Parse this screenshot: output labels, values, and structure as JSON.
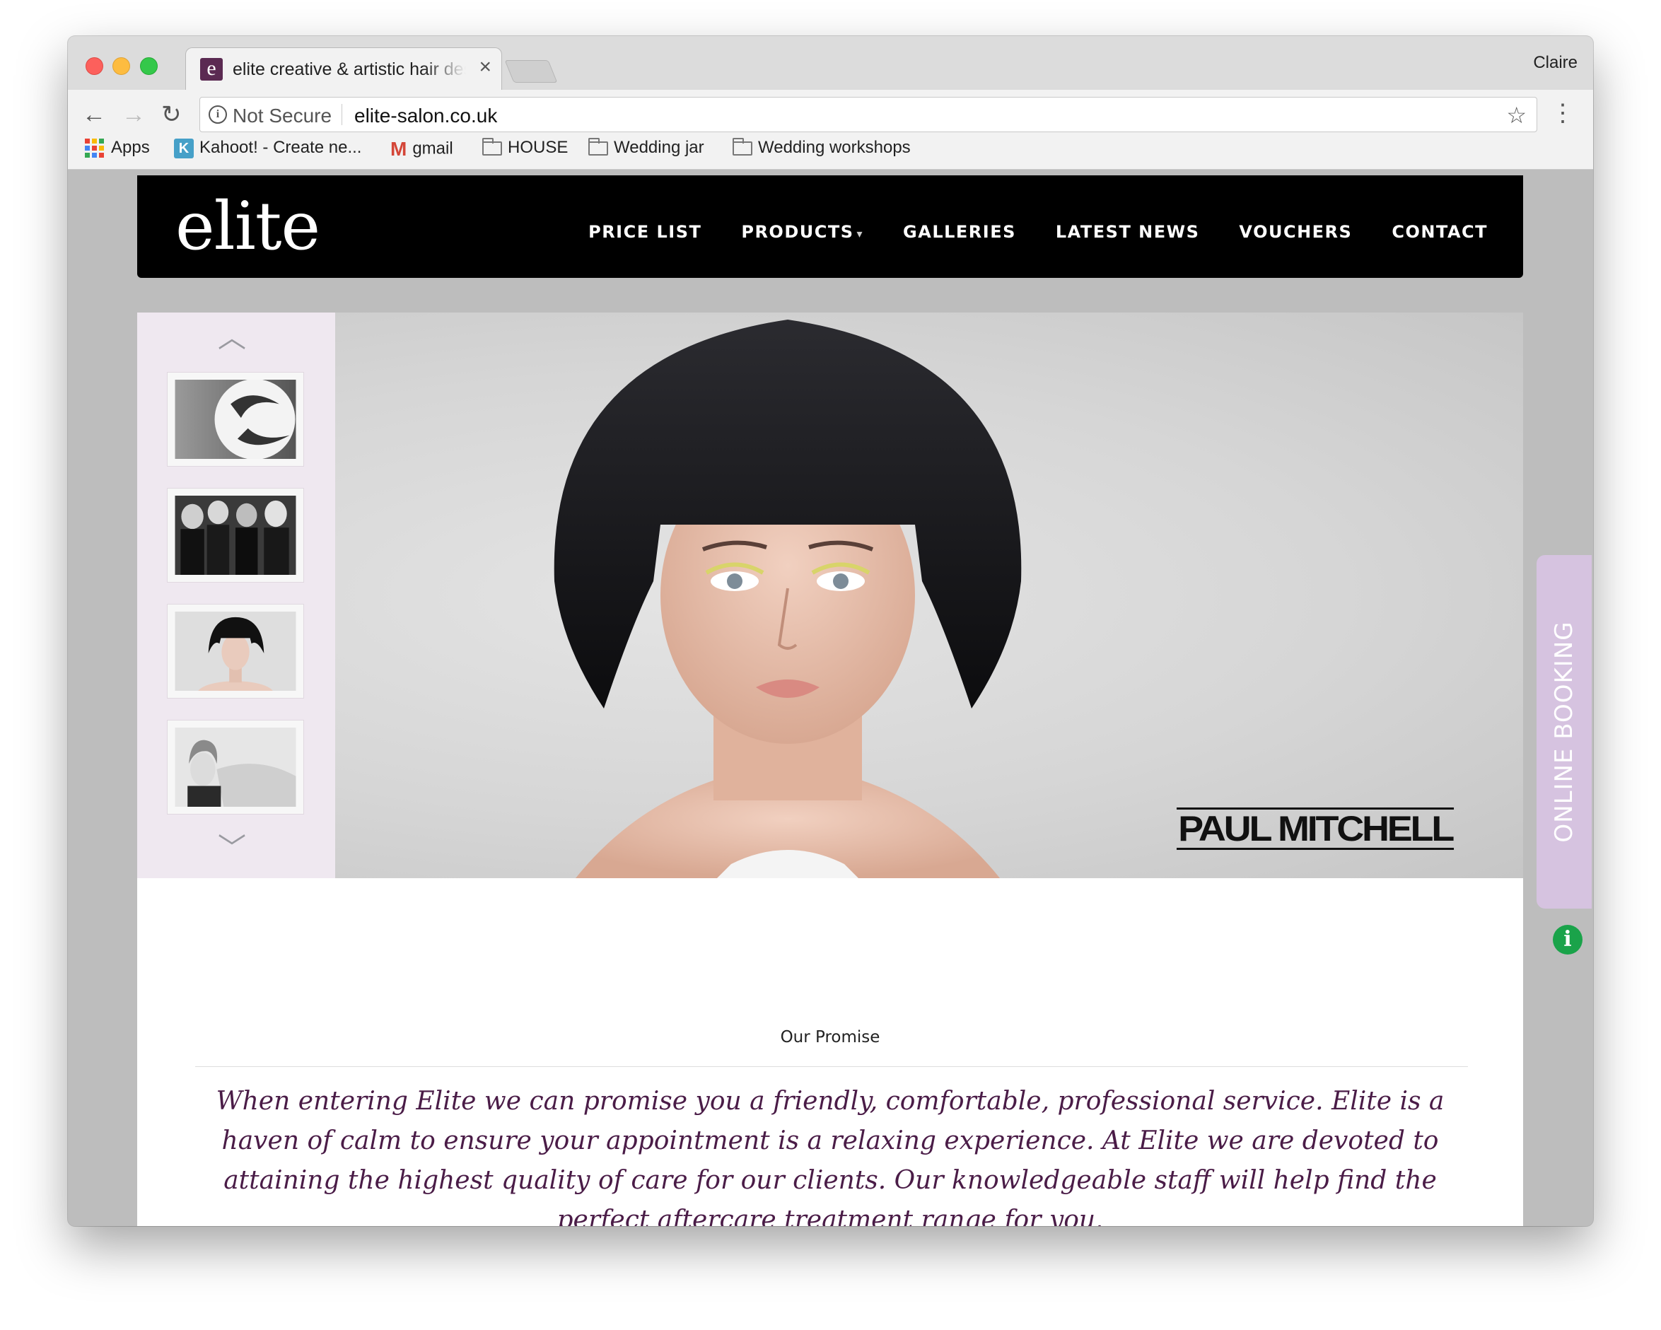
{
  "browser": {
    "tab_title": "elite creative & artistic hair design",
    "tab_close": "×",
    "profile_name": "Claire",
    "security_label": "Not Secure",
    "url": "elite-salon.co.uk",
    "back_glyph": "←",
    "forward_glyph": "→",
    "reload_glyph": "↻",
    "star_glyph": "☆",
    "menu_glyph": "⋮",
    "bookmarks": [
      {
        "label": "Apps",
        "icon": "apps-grid-icon"
      },
      {
        "label": "Kahoot! - Create ne...",
        "icon": "kahoot-icon"
      },
      {
        "label": "gmail",
        "icon": "gmail-icon"
      },
      {
        "label": "HOUSE",
        "icon": "folder-icon"
      },
      {
        "label": "Wedding jar",
        "icon": "folder-icon"
      },
      {
        "label": "Wedding workshops",
        "icon": "folder-icon"
      }
    ]
  },
  "site": {
    "logo": "elite",
    "nav": [
      {
        "label": "PRICE LIST"
      },
      {
        "label": "PRODUCTS"
      },
      {
        "label": "GALLERIES"
      },
      {
        "label": "LATEST NEWS"
      },
      {
        "label": "VOUCHERS"
      },
      {
        "label": "CONTACT"
      }
    ],
    "slider": {
      "chevron_up": "︿",
      "chevron_down": "﹀",
      "brand_logo": "PAUL MITCHELL"
    },
    "promise": {
      "title": "Our Promise",
      "text": "When entering Elite we can promise you a friendly, comfortable, professional service. Elite is a haven of calm to ensure your appointment is a relaxing experience. At Elite we are devoted to attaining the highest quality of care for our clients. Our knowledgeable staff will help find the perfect aftercare treatment range for you."
    },
    "booking_tab": "ONLINE BOOKING",
    "help_glyph": "i"
  },
  "colors": {
    "header_bg": "#000000",
    "thumb_panel_bg": "#efe8f0",
    "booking_tab_bg": "#d6c3e0",
    "promise_text": "#4a1c47",
    "help_icon": "#1aa34a"
  }
}
